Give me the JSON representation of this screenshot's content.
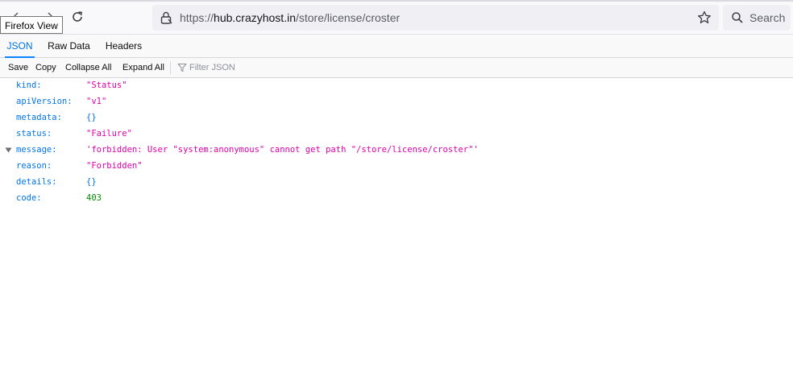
{
  "browser": {
    "tooltip": "Firefox View",
    "url": {
      "scheme": "https://",
      "host": "hub.crazyhost.in",
      "path": "/store/license/croster"
    },
    "search_label": "Search",
    "icons": [
      "back-icon",
      "forward-icon",
      "reload-icon",
      "lock-icon",
      "bookmark-star-icon",
      "search-icon"
    ]
  },
  "viewer": {
    "tabs": [
      {
        "label": "JSON",
        "active": true
      },
      {
        "label": "Raw Data",
        "active": false
      },
      {
        "label": "Headers",
        "active": false
      }
    ],
    "toolbar": {
      "save": "Save",
      "copy": "Copy",
      "collapse_all": "Collapse All",
      "expand_all": "Expand All",
      "filter_placeholder": "Filter JSON"
    },
    "rows": [
      {
        "key": "kind:",
        "value": "\"Status\"",
        "type": "string"
      },
      {
        "key": "apiVersion:",
        "value": "\"v1\"",
        "type": "string"
      },
      {
        "key": "metadata:",
        "value": "{}",
        "type": "object"
      },
      {
        "key": "status:",
        "value": "\"Failure\"",
        "type": "string"
      },
      {
        "key": "message:",
        "value": "'forbidden: User \"system:anonymous\" cannot get path \"/store/license/croster\"'",
        "type": "string"
      },
      {
        "key": "reason:",
        "value": "\"Forbidden\"",
        "type": "string"
      },
      {
        "key": "details:",
        "value": "{}",
        "type": "object"
      },
      {
        "key": "code:",
        "value": "403",
        "type": "number"
      }
    ]
  },
  "colors": {
    "key": "#0074e8",
    "string": "#dd00a9",
    "number": "#058b00",
    "active_tab": "#0a84ff"
  }
}
